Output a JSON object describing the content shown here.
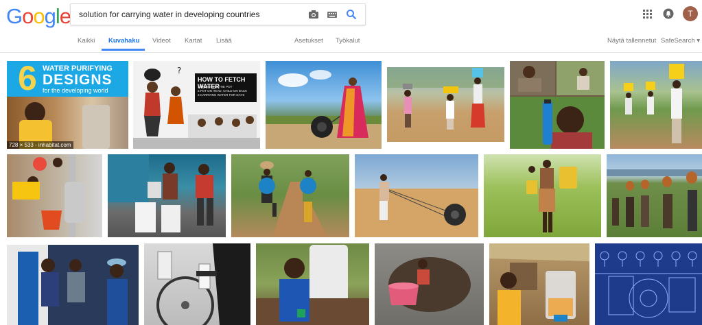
{
  "logo": {
    "letters": [
      "G",
      "o",
      "o",
      "g",
      "l",
      "e"
    ],
    "colors": [
      "#4285F4",
      "#EA4335",
      "#FBBC05",
      "#4285F4",
      "#34A853",
      "#EA4335"
    ]
  },
  "search": {
    "query": "solution for carrying water in developing countries",
    "camera_icon": "camera-icon",
    "keyboard_icon": "keyboard-icon",
    "search_icon": "search-icon"
  },
  "header": {
    "apps_icon": "apps-grid-icon",
    "notifications_icon": "notifications-icon",
    "avatar_letter": "T"
  },
  "tabs": {
    "all": "Kaikki",
    "images": "Kuvahaku",
    "videos": "Videot",
    "maps": "Kartat",
    "more": "Lisää",
    "settings": "Asetukset",
    "tools": "Työkalut",
    "saved": "Näytä tallennetut",
    "safesearch": "SafeSearch ▾"
  },
  "results": {
    "first_banner_number": "6",
    "first_banner_line1": "WATER PURIFYING",
    "first_banner_line2": "DESIGNS",
    "first_banner_line3": "for the developing world",
    "first_caption": "728 × 533 - inhabitat.com",
    "cartoon_sign_title": "HOW TO FETCH WATER",
    "cartoon_sign_line1": "1.BALANCING THE POT",
    "cartoon_sign_line2": "2.POT ON HEAD, CHILD ON BACK",
    "cartoon_sign_line3": "3.CARRYING WATER FOR DAYS"
  },
  "colors": {
    "accent": "#4285f4",
    "tab_text": "#777777",
    "active_tab": "#1a73e8"
  }
}
